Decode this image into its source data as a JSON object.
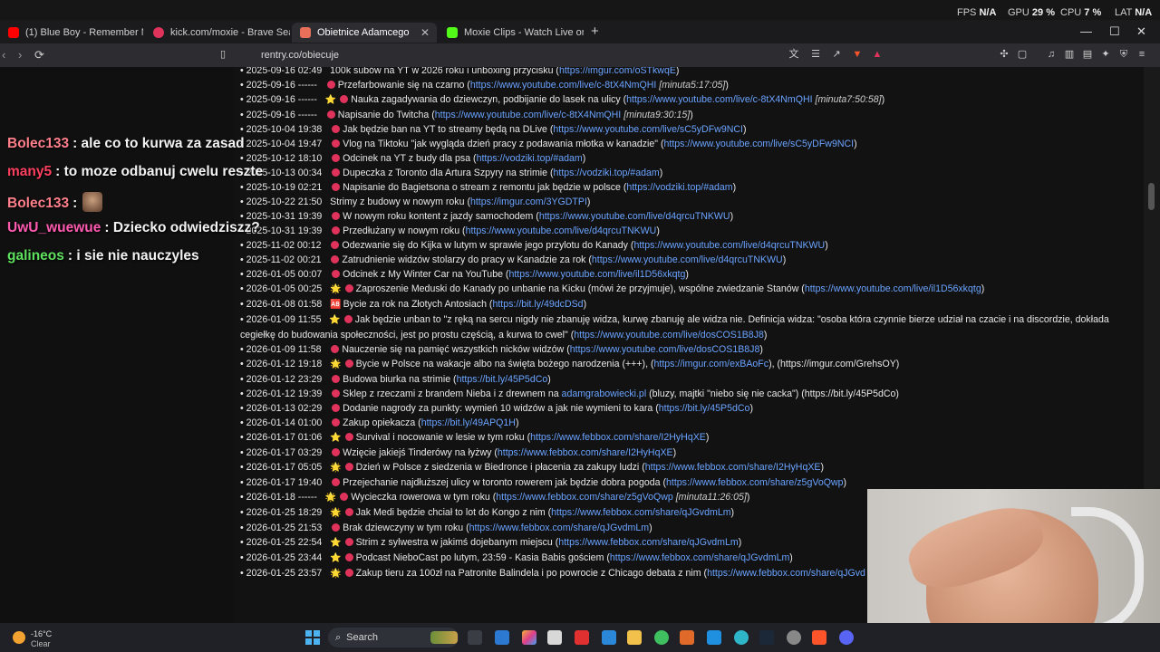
{
  "stats": {
    "fps_label": "FPS",
    "fps_value": "N/A",
    "gpu_label": "GPU",
    "gpu_value": "29 %",
    "cpu_label": "CPU",
    "cpu_value": "7 %",
    "lat_label": "LAT",
    "lat_value": "N/A"
  },
  "tabs": [
    {
      "title": "(1) Blue Boy - Remember Me (Or",
      "icon_color": "#ff0000"
    },
    {
      "title": "kick.com/moxie - Brave Search",
      "icon_color": "#e0335c"
    },
    {
      "title": "Obietnice Adamcego",
      "icon_color": "#e8705a"
    },
    {
      "title": "Moxie Clips - Watch Live on Kick",
      "icon_color": "#53fc18"
    }
  ],
  "url": "rentry.co/obiecuje",
  "entries": [
    {
      "date": "2025-09-16 02:49",
      "emoji": "",
      "dot": false,
      "text": "100k subów na YT w 2026 roku i unboxing przycisku (",
      "link": "https://imgur.com/oSTkwqE",
      "after": ")"
    },
    {
      "date": "2025-09-16 ------",
      "emoji": "",
      "dot": true,
      "text": "Przefarbowanie się na czarno (",
      "link": "https://www.youtube.com/live/c-8tX4NmQHI",
      "note": " [minuta5:17:05]",
      "after": ")"
    },
    {
      "date": "2025-09-16 ------",
      "emoji": "⭐",
      "dot": true,
      "text": "Nauka zagadywania do dziewczyn, podbijanie do lasek na ulicy (",
      "link": "https://www.youtube.com/live/c-8tX4NmQHI",
      "note": " [minuta7:50:58]",
      "after": ")"
    },
    {
      "date": "2025-09-16 ------",
      "emoji": "",
      "dot": true,
      "text": "Napisanie do Twitcha (",
      "link": "https://www.youtube.com/live/c-8tX4NmQHI",
      "note": " [minuta9:30:15]",
      "after": ")"
    },
    {
      "date": "2025-10-04 19:38",
      "emoji": "",
      "dot": true,
      "text": "Jak będzie ban na YT to streamy będą na DLive (",
      "link": "https://www.youtube.com/live/sC5yDFw9NCI",
      "after": ")"
    },
    {
      "date": "2025-10-04 19:47",
      "emoji": "",
      "dot": true,
      "text": "Vlog na Tiktoku \"jak wygląda dzień pracy z podawania młotka w kanadzie\" (",
      "link": "https://www.youtube.com/live/sC5yDFw9NCI",
      "after": ")"
    },
    {
      "date": "2025-10-12 18:10",
      "emoji": "",
      "dot": true,
      "text": "Odcinek na YT z budy dla psa (",
      "link": "https://vodziki.top/#adam",
      "after": ")"
    },
    {
      "date": "2025-10-13 00:34",
      "emoji": "",
      "dot": true,
      "text": "Dupeczka z Toronto dla Artura Szpyry na strimie (",
      "link": "https://vodziki.top/#adam",
      "after": ")"
    },
    {
      "date": "2025-10-19 02:21",
      "emoji": "",
      "dot": true,
      "text": "Napisanie do Bagietsona o stream z remontu jak będzie w polsce (",
      "link": "https://vodziki.top/#adam",
      "after": ")"
    },
    {
      "date": "2025-10-22 21:50",
      "emoji": "",
      "dot": false,
      "text": "Strimy z budowy w nowym roku (",
      "link": "https://imgur.com/3YGDTPI",
      "after": ")"
    },
    {
      "date": "2025-10-31 19:39",
      "emoji": "",
      "dot": true,
      "text": "W nowym roku kontent z jazdy samochodem (",
      "link": "https://www.youtube.com/live/d4qrcuTNKWU",
      "after": ")"
    },
    {
      "date": "2025-10-31 19:39",
      "emoji": "",
      "dot": true,
      "text": "Przedłużany w nowym roku (",
      "link": "https://www.youtube.com/live/d4qrcuTNKWU",
      "after": ")"
    },
    {
      "date": "2025-11-02 00:12",
      "emoji": "",
      "dot": true,
      "text": "Odezwanie się do Kijka w lutym w sprawie jego przylotu do Kanady (",
      "link": "https://www.youtube.com/live/d4qrcuTNKWU",
      "after": ")"
    },
    {
      "date": "2025-11-02 00:21",
      "emoji": "",
      "dot": true,
      "text": "Zatrudnienie widzów stolarzy do pracy w Kanadzie za rok (",
      "link": "https://www.youtube.com/live/d4qrcuTNKWU",
      "after": ")"
    },
    {
      "date": "2026-01-05 00:07",
      "emoji": "",
      "dot": true,
      "text": "Odcinek z My Winter Car na YouTube (",
      "link": "https://www.youtube.com/live/il1D56xkqtg",
      "after": ")"
    },
    {
      "date": "2026-01-05 00:25",
      "emoji": "🌟",
      "dot": true,
      "wrap": true,
      "text": "Zaproszenie Meduski do Kanady po unbanie na Kicku (mówi że przyjmuje), wspólne zwiedzanie Stanów (",
      "link": "https://www.youtube.com/live/il1D56xkqtg",
      "after": ")"
    },
    {
      "date": "2026-01-08 01:58",
      "emoji": "🆎",
      "dot": false,
      "text": "Bycie za rok na Złotych Antosiach (",
      "link": "https://bit.ly/49dcDSd",
      "after": ")"
    },
    {
      "date": "2026-01-09 11:55",
      "emoji": "⭐",
      "dot": true,
      "wrap": true,
      "text": "Jak będzie unban to \"z ręką na sercu nigdy nie zbanuję widza, kurwę zbanuję ale widza nie. Definicja widza: \"osoba która czynnie bierze udział na czacie i na discordzie, dokłada cegiełkę do budowania społeczności, jest po prostu częścią, a kurwa to cwel\" (",
      "link": "https://www.youtube.com/live/dosCOS1B8J8",
      "after": ")"
    },
    {
      "date": "2026-01-09 11:58",
      "emoji": "",
      "dot": true,
      "text": "Nauczenie się na pamięć wszystkich nicków widzów (",
      "link": "https://www.youtube.com/live/dosCOS1B8J8",
      "after": ")"
    },
    {
      "date": "2026-01-12 19:18",
      "emoji": "🌟",
      "dot": true,
      "wrap": true,
      "text": "Bycie w Polsce na wakacje albo na święta bożego narodzenia (+++), (",
      "link": "https://imgur.com/exBAoFc",
      "after": "), (https://imgur.com/GrehsOY)"
    },
    {
      "date": "2026-01-12 23:29",
      "emoji": "",
      "dot": true,
      "text": "Budowa biurka na strimie (",
      "link": "https://bit.ly/45P5dCo",
      "after": ")"
    },
    {
      "date": "2026-01-12 19:39",
      "emoji": "",
      "dot": true,
      "wrap": true,
      "text": "Sklep z rzeczami z brandem Nieba i z drewnem na ",
      "link": "adamgrabowiecki.pl",
      "after": " (bluzy, majtki \"niebo się nie cacka\") (https://bit.ly/45P5dCo)"
    },
    {
      "date": "2026-01-13 02:29",
      "emoji": "",
      "dot": true,
      "text": "Dodanie nagrody za punkty: wymień 10 widzów a jak nie wymieni to kara (",
      "link": "https://bit.ly/45P5dCo",
      "after": ")"
    },
    {
      "date": "2026-01-14 01:00",
      "emoji": "",
      "dot": true,
      "text": "Zakup opiekacza (",
      "link": "https://bit.ly/49APQ1H",
      "after": ")"
    },
    {
      "date": "2026-01-17 01:06",
      "emoji": "⭐",
      "dot": true,
      "text": "Survival i nocowanie w lesie w tym roku (",
      "link": "https://www.febbox.com/share/I2HyHqXE",
      "after": ")"
    },
    {
      "date": "2026-01-17 03:29",
      "emoji": "",
      "dot": true,
      "text": "Wzięcie jakiejś Tinderówy na łyżwy (",
      "link": "https://www.febbox.com/share/I2HyHqXE",
      "after": ")"
    },
    {
      "date": "2026-01-17 05:05",
      "emoji": "🌟",
      "dot": true,
      "text": "Dzień w Polsce z siedzenia w Biedronce i płacenia za zakupy ludzi (",
      "link": "https://www.febbox.com/share/I2HyHqXE",
      "after": ")"
    },
    {
      "date": "2026-01-17 19:40",
      "emoji": "",
      "dot": true,
      "text": "Przejechanie najdłuższej ulicy w toronto rowerem jak będzie dobra pogoda (",
      "link": "https://www.febbox.com/share/z5gVoQwp",
      "after": ")"
    },
    {
      "date": "2026-01-18 ------",
      "emoji": "🌟",
      "dot": true,
      "text": "Wycieczka rowerowa w tym roku (",
      "link": "https://www.febbox.com/share/z5gVoQwp",
      "note": " [minuta11:26:05]",
      "after": ")"
    },
    {
      "date": "2026-01-25 18:29",
      "emoji": "🌟",
      "dot": true,
      "text": "Jak Medi będzie chciał to lot do Kongo z nim (",
      "link": "https://www.febbox.com/share/qJGvdmLm",
      "after": ")"
    },
    {
      "date": "2026-01-25 21:53",
      "emoji": "",
      "dot": true,
      "text": "Brak dziewczyny w tym roku (",
      "link": "https://www.febbox.com/share/qJGvdmLm",
      "after": ")"
    },
    {
      "date": "2026-01-25 22:54",
      "emoji": "⭐",
      "dot": true,
      "text": "Strim z sylwestra w jakimś dojebanym miejscu (",
      "link": "https://www.febbox.com/share/qJGvdmLm",
      "after": ")"
    },
    {
      "date": "2026-01-25 23:44",
      "emoji": "⭐",
      "dot": true,
      "text": "Podcast NieboCast po lutym, 23:59 - Kasia Babis gościem (",
      "link": "https://www.febbox.com/share/qJGvdmLm",
      "after": ")"
    },
    {
      "date": "2026-01-25 23:57",
      "emoji": "🌟",
      "dot": true,
      "text": "Zakup tieru za 100zł na Patronite Balindela i po powrocie z Chicago debata z nim (",
      "link": "https://www.febbox.com/share/qJGvd",
      "after": ""
    }
  ],
  "chat": [
    {
      "user": "Bolec133",
      "color": "#ff7f8a",
      "text": ": ale co to kurwa za zasad"
    },
    {
      "user": "many5",
      "color": "#ff3f5f",
      "text": ": to moze odbanuj cwelu reszte"
    },
    {
      "user": "Bolec133",
      "color": "#ff7f8a",
      "text": ":"
    },
    {
      "user": "UwU_wuewue",
      "color": "#ff5ab0",
      "text": ": Dziecko odwiedziszz?"
    },
    {
      "user": "galineos",
      "color": "#5fe05f",
      "text": ": i sie nie nauczyles"
    }
  ],
  "taskbar": {
    "temperature": "-16°C",
    "condition": "Clear",
    "search_label": "Search"
  }
}
